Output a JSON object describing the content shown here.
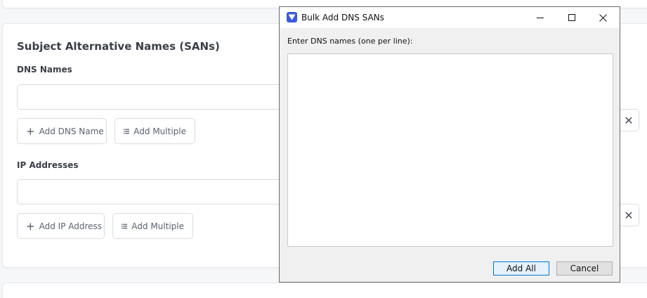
{
  "san": {
    "title": "Subject Alternative Names (SANs)",
    "dns": {
      "label": "DNS Names",
      "input_value": "",
      "add_label": "Add DNS Name",
      "multi_label": "Add Multiple",
      "remove_glyph": "✕"
    },
    "ip": {
      "label": "IP Addresses",
      "input_value": "",
      "add_label": "Add IP Address",
      "multi_label": "Add Multiple",
      "remove_glyph": "✕"
    },
    "plus_glyph": "+",
    "icons": {
      "add": "plus-icon",
      "multi": "list-icon",
      "remove": "close-icon"
    }
  },
  "dialog": {
    "title": "Bulk Add DNS SANs",
    "prompt": "Enter DNS names (one per line):",
    "textarea_value": "",
    "add_all_label": "Add All",
    "cancel_label": "Cancel",
    "icon_color": "#3b5bdb",
    "icons": {
      "app": "shield-icon",
      "minimize": "minimize-icon",
      "maximize": "maximize-icon",
      "close": "close-icon"
    }
  }
}
